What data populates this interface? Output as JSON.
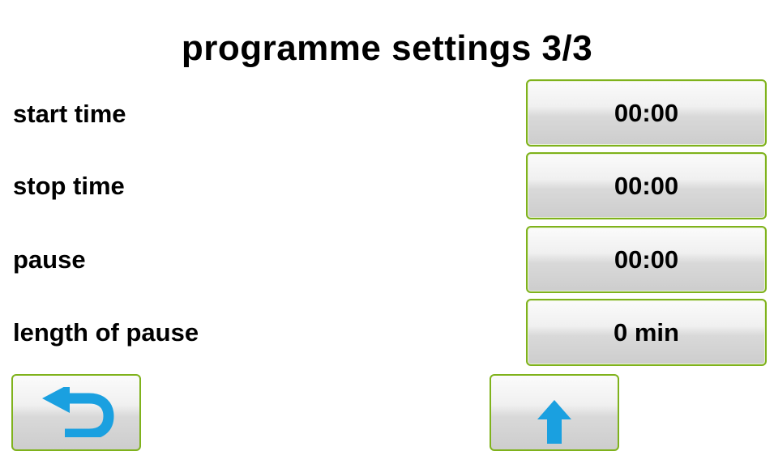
{
  "header": {
    "title": "programme settings 3/3"
  },
  "rows": [
    {
      "label": "start time",
      "value": "00:00"
    },
    {
      "label": "stop time",
      "value": "00:00"
    },
    {
      "label": "pause",
      "value": "00:00"
    },
    {
      "label": "length of pause",
      "value": "0 min"
    }
  ],
  "nav": {
    "back_icon": "return-arrow-icon",
    "up_icon": "arrow-up-icon"
  },
  "colors": {
    "button_border": "#7fb21c",
    "icon_blue": "#1aa0e0"
  }
}
